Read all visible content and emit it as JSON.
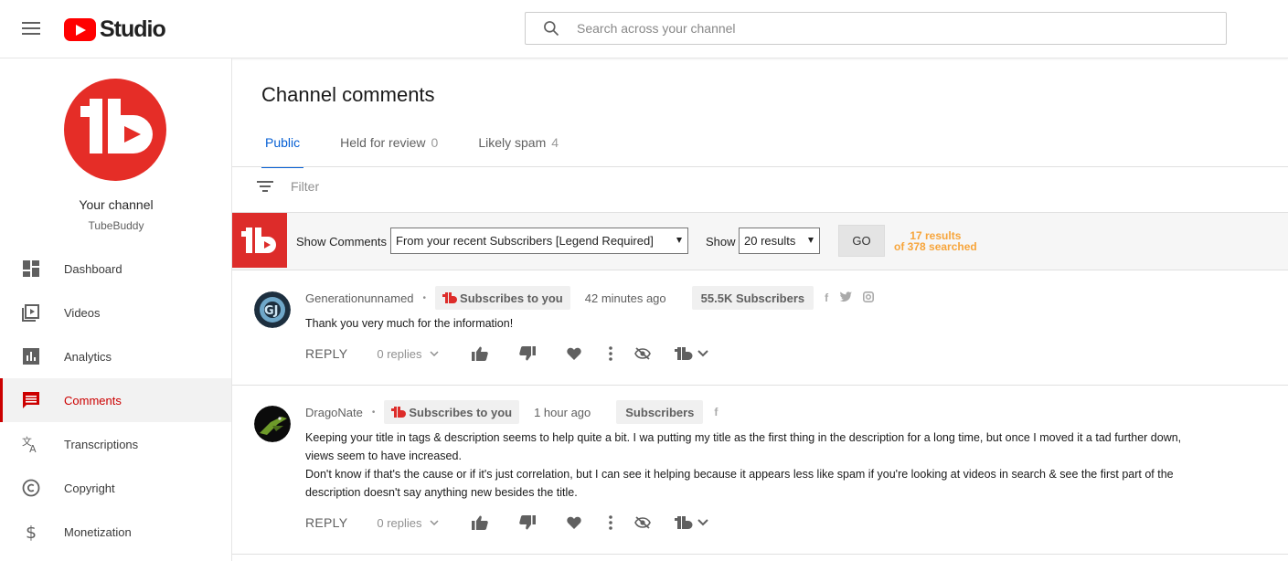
{
  "header": {
    "logo_text": "Studio",
    "search_placeholder": "Search across your channel"
  },
  "sidebar": {
    "channel_label": "Your channel",
    "channel_name": "TubeBuddy",
    "items": [
      {
        "label": "Dashboard",
        "icon": "dashboard-icon"
      },
      {
        "label": "Videos",
        "icon": "videos-icon"
      },
      {
        "label": "Analytics",
        "icon": "analytics-icon"
      },
      {
        "label": "Comments",
        "icon": "comments-icon",
        "active": true
      },
      {
        "label": "Transcriptions",
        "icon": "transcriptions-icon"
      },
      {
        "label": "Copyright",
        "icon": "copyright-icon"
      },
      {
        "label": "Monetization",
        "icon": "monetization-icon"
      }
    ]
  },
  "main": {
    "title": "Channel comments",
    "tabs": [
      {
        "label": "Public",
        "count": ""
      },
      {
        "label": "Held for review",
        "count": "0"
      },
      {
        "label": "Likely spam",
        "count": "4"
      }
    ],
    "filter_label": "Filter"
  },
  "tubebuddy": {
    "show_comments_label": "Show Comments",
    "comments_select": "From your recent Subscribers [Legend Required]",
    "show_label": "Show",
    "results_select": "20 results",
    "go_label": "GO",
    "results_line1": "17 results",
    "results_line2": "of 378 searched",
    "accent": "#dd2c2a",
    "results_color": "#f7a53b"
  },
  "comments": [
    {
      "author": "Generationunnamed",
      "badge": "Subscribes to you",
      "time": "42 minutes ago",
      "subscribers": "55.5K Subscribers",
      "text": "Thank you very much for the information!",
      "reply_label": "REPLY",
      "replies_label": "0 replies"
    },
    {
      "author": "DragoNate",
      "badge": "Subscribes to you",
      "time": "1 hour ago",
      "subscribers": "Subscribers",
      "text_line1": "Keeping your title in tags & description seems to help quite a bit. I wa putting my title as the first thing in the description for a long time, but once I moved it a tad further down, views seem to have increased.",
      "text_line2": "Don't know if that's the cause or if it's just correlation, but I can see it helping because it appears less like spam if you're looking at videos in search & see the first part of the description doesn't say anything new besides the title.",
      "reply_label": "REPLY",
      "replies_label": "0 replies"
    }
  ]
}
